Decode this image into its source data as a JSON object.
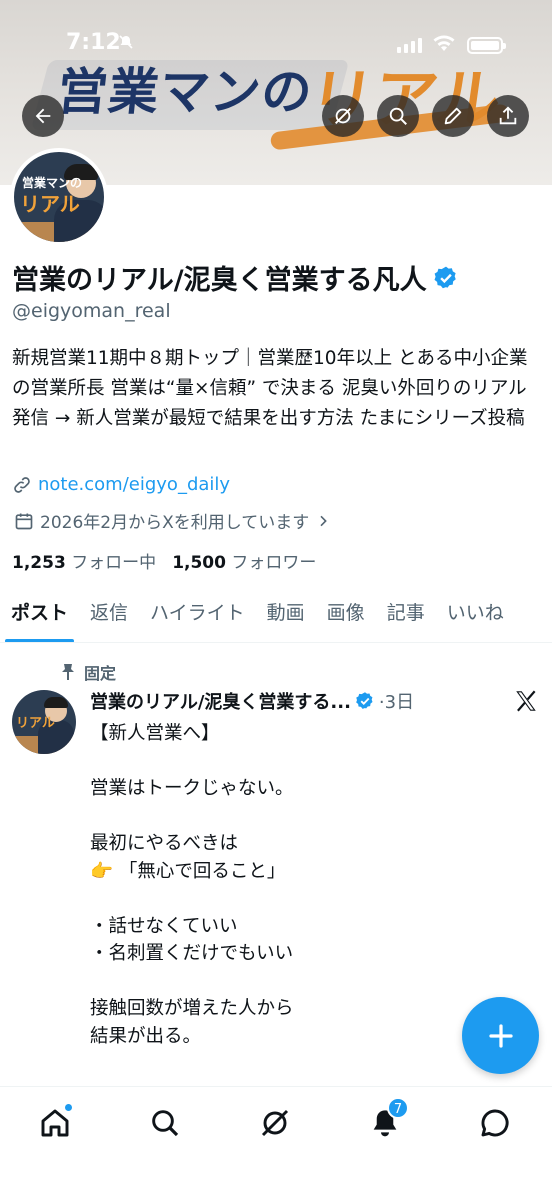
{
  "status_bar": {
    "time": "7:12"
  },
  "banner": {
    "title": "営業マンの",
    "accent": "リアル"
  },
  "avatar": {
    "line1": "営業マンの",
    "line2": "リアル"
  },
  "profile": {
    "display_name": "営業のリアル/泥臭く営業する凡人",
    "handle": "@eigyoman_real",
    "bio": "新規営業11期中８期トップ｜営業歴10年以上 とある中小企業の営業所長 営業は“量×信頼” で決まる 泥臭い外回りのリアル発信 → 新人営業が最短で結果を出す方法 たまにシリーズ投稿",
    "link": "note.com/eigyo_daily",
    "joined": "2026年2月からXを利用しています",
    "following_count": "1,253",
    "following_label": "フォロー中",
    "followers_count": "1,500",
    "followers_label": "フォロワー"
  },
  "tabs": [
    "ポスト",
    "返信",
    "ハイライト",
    "動画",
    "画像",
    "記事",
    "いいね"
  ],
  "post": {
    "pinned_label": "固定",
    "author": "営業のリアル/泥臭く営業する...",
    "time": "·3日",
    "body": "【新人営業へ】\n\n営業はトークじゃない。\n\n最初にやるべきは\n👉 「無心で回ること」\n\n・話せなくていい\n・名刺置くだけでもいい\n\n接触回数が増えた人から\n結果が出る。"
  },
  "bottom_nav": {
    "notifications_badge": "7"
  },
  "colors": {
    "accent": "#1d9bf0",
    "text": "#0f1419",
    "muted": "#536471",
    "banner_navy": "#1d3566",
    "banner_orange": "#e28b2d"
  },
  "icons": [
    "back-arrow-icon",
    "grok-icon",
    "search-icon",
    "edit-icon",
    "share-icon",
    "verified-badge-icon",
    "link-icon",
    "calendar-icon",
    "chevron-right-icon",
    "pin-icon",
    "x-logo-icon",
    "plus-icon",
    "home-icon",
    "explore-icon",
    "grok-nav-icon",
    "bell-icon",
    "messages-icon"
  ]
}
